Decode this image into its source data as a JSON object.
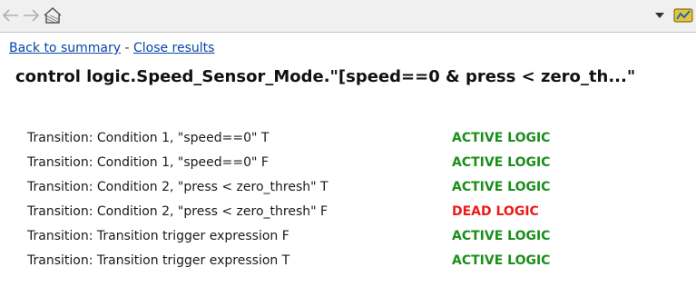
{
  "toolbar": {
    "back_icon": "back-arrow-icon",
    "forward_icon": "forward-arrow-icon",
    "home_icon": "home-icon",
    "dropdown_icon": "chevron-down-icon",
    "app_icon": "report-app-icon"
  },
  "links": {
    "back_label": "Back to summary",
    "separator": " - ",
    "close_label": "Close results"
  },
  "title": "control logic.Speed_Sensor_Mode.\"[speed==0 & press < zero_th...\"",
  "colors": {
    "active": "#1b8f1b",
    "dead": "#ee1a1a",
    "link": "#0645ad"
  },
  "results": [
    {
      "description": "Transition: Condition 1, \"speed==0\" T",
      "status": "ACTIVE LOGIC",
      "kind": "active"
    },
    {
      "description": "Transition: Condition 1, \"speed==0\" F",
      "status": "ACTIVE LOGIC",
      "kind": "active"
    },
    {
      "description": "Transition: Condition 2, \"press < zero_thresh\" T",
      "status": "ACTIVE LOGIC",
      "kind": "active"
    },
    {
      "description": "Transition: Condition 2, \"press < zero_thresh\" F",
      "status": "DEAD LOGIC",
      "kind": "dead"
    },
    {
      "description": "Transition: Transition trigger expression F",
      "status": "ACTIVE LOGIC",
      "kind": "active"
    },
    {
      "description": "Transition: Transition trigger expression T",
      "status": "ACTIVE LOGIC",
      "kind": "active"
    }
  ]
}
